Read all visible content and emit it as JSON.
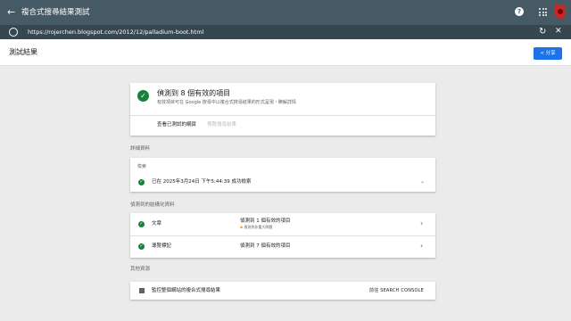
{
  "topbar": {
    "back_glyph": "←",
    "title": "複合式搜尋結果測試",
    "help_glyph": "?",
    "icons": [
      "arrow-left-icon",
      "help-icon",
      "apps-grid-icon",
      "avatar"
    ]
  },
  "urlbar": {
    "url": "https://rojerchen.blogspot.com/2012/12/palladium-boot.html",
    "refresh_glyph": "↻",
    "close_glyph": "✕",
    "icons": [
      "globe-icon",
      "refresh-icon",
      "close-icon"
    ]
  },
  "header": {
    "title": "測試結果",
    "share_label": "< 分享"
  },
  "summary": {
    "title": "偵測到 8 個有效的項目",
    "subtitle": "有效項目可在 Google 搜尋中以複合式搜尋結果的形式呈現・瞭解詳情",
    "action_view_page": "查看已測試的網頁",
    "action_preview": "預覽搜尋結果"
  },
  "details": {
    "section_label": "詳細資料",
    "label": "檢索",
    "status": "已在 2025年3月24日 下午5:44:39 成功檢索",
    "chevron": "⌄"
  },
  "structured": {
    "section_label": "偵測到的結構化資料",
    "rows": [
      {
        "name": "文章",
        "result": "偵測到 1 個有效的項目",
        "warning": "偵測到非重大問題"
      },
      {
        "name": "導覽標記",
        "result": "偵測到 7 個有效的項目"
      }
    ],
    "chevron": "›"
  },
  "other": {
    "section_label": "其他資源",
    "item_text": "監控整個網站的複合式搜尋結果",
    "link_label": "前往 SEARCH CONSOLE"
  },
  "colors": {
    "topbar": "#455a64",
    "urlbar": "#37474f",
    "accent": "#1a73e8",
    "success": "#188038",
    "warning": "#f29900"
  }
}
